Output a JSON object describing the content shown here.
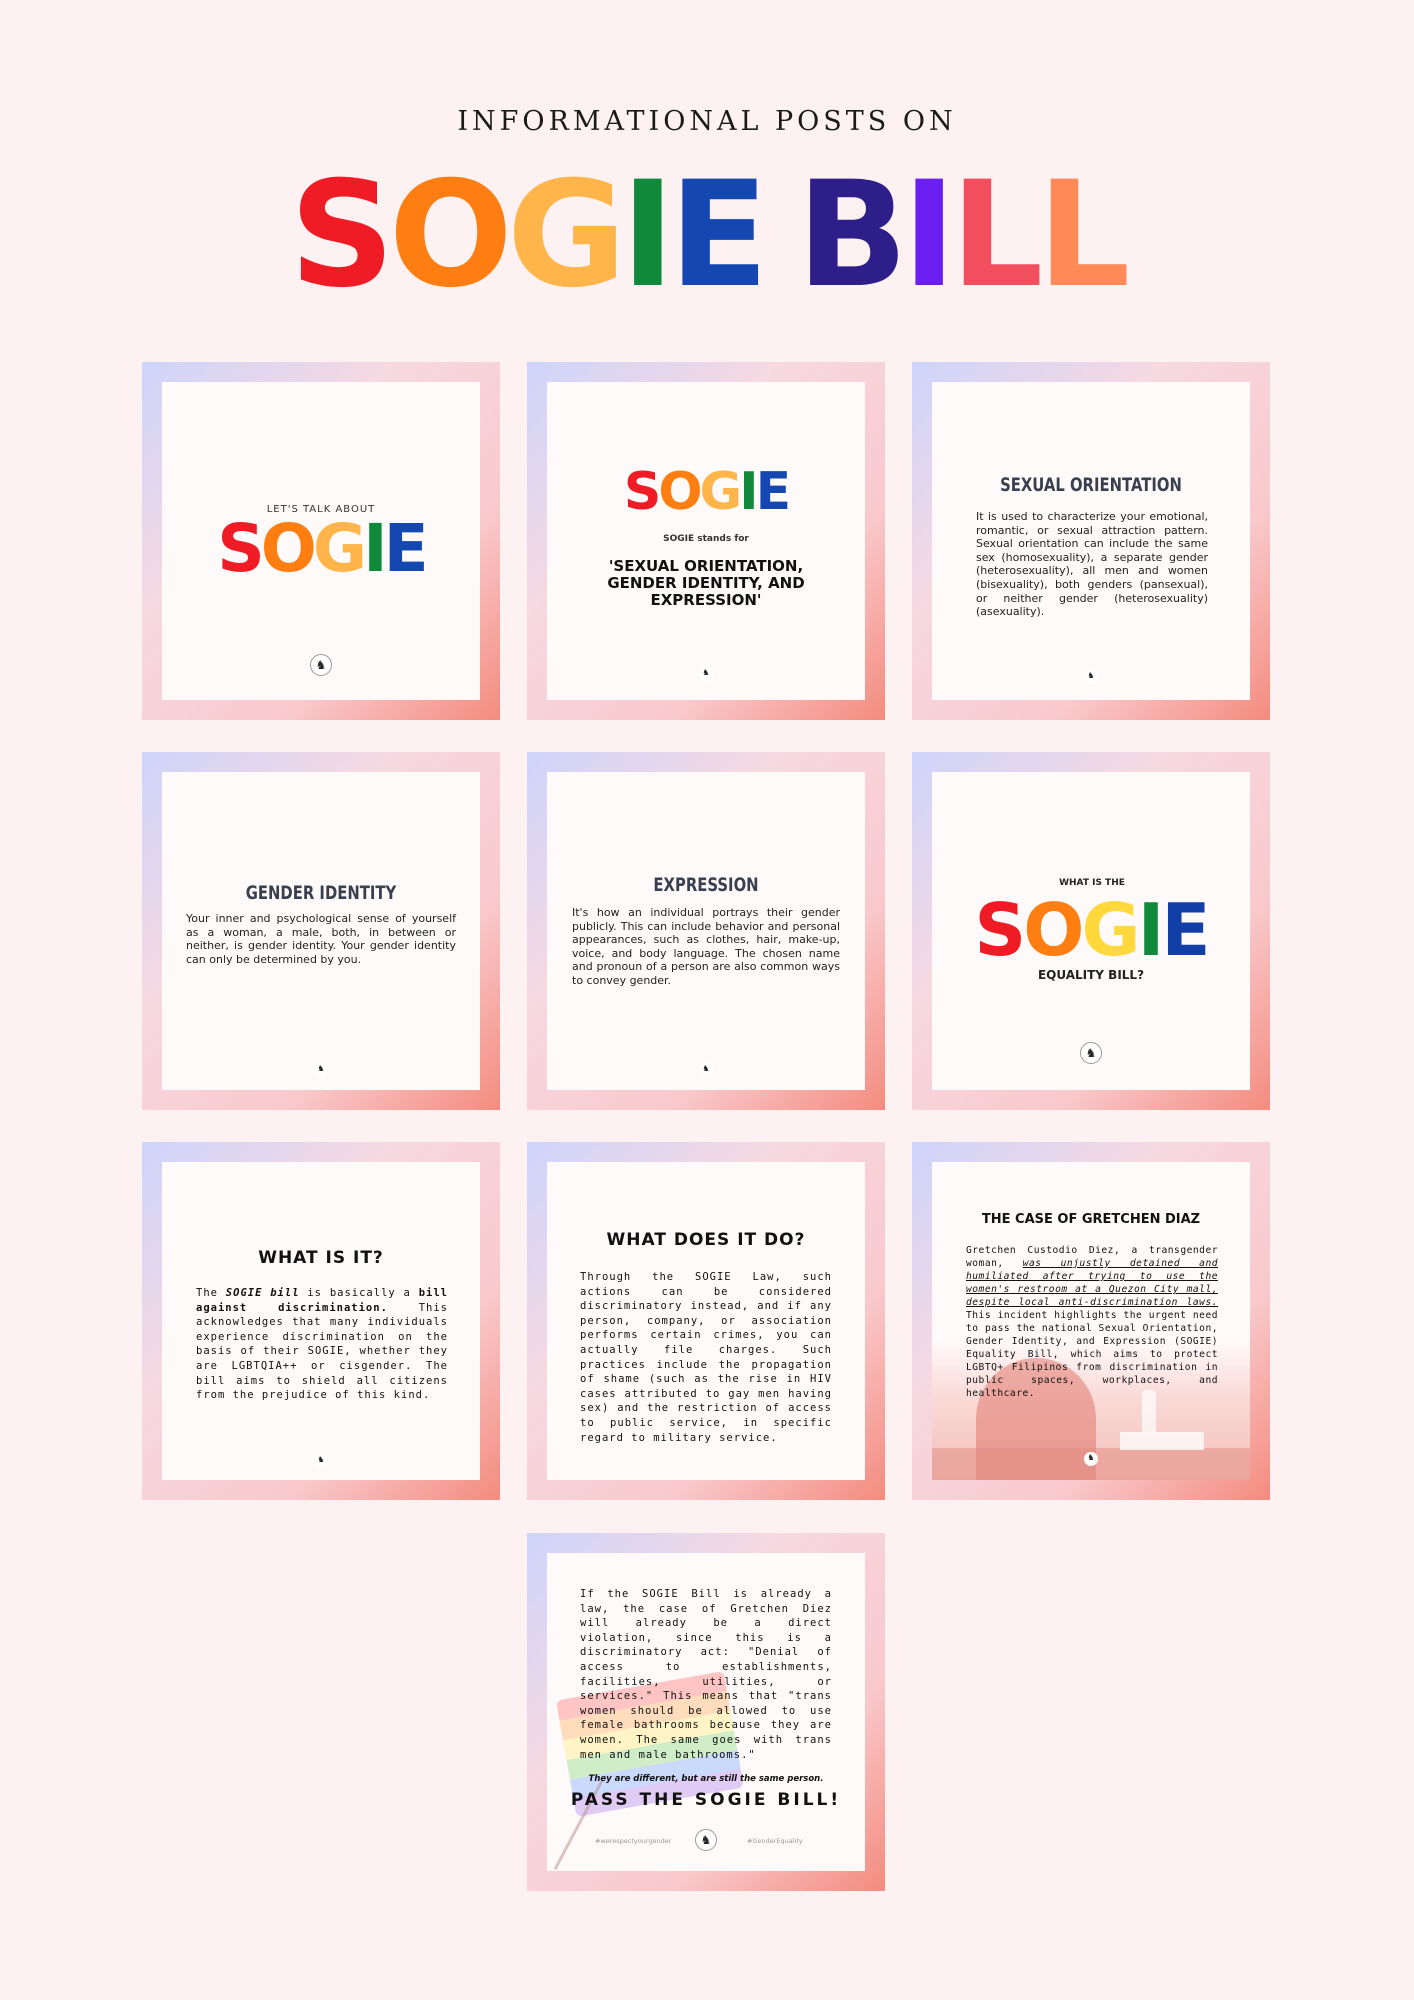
{
  "header": {
    "subtitle": "INFORMATIONAL POSTS ON",
    "title_letters": [
      "S",
      "O",
      "G",
      "I",
      "E",
      " ",
      "B",
      "I",
      "L",
      "L"
    ],
    "title_colors": [
      "#ef1c25",
      "#ff7e12",
      "#ffb54a",
      "#108a3a",
      "#1448b0",
      "",
      "#2d1e8a",
      "#6a1ef0",
      "#f24f5e",
      "#ff8a57"
    ]
  },
  "logo_glyph": "♞",
  "sogie_letters": [
    "S",
    "O",
    "G",
    "I",
    "E"
  ],
  "posts": {
    "p1": {
      "kicker": "LET'S TALK ABOUT"
    },
    "p2": {
      "stands_for": "SOGIE stands for",
      "expansion": "'SEXUAL ORIENTATION, GENDER IDENTITY, AND EXPRESSION'"
    },
    "p3": {
      "heading": "SEXUAL ORIENTATION",
      "body": "It is used to characterize your emotional, romantic, or sexual attraction pattern. Sexual orientation can include the same sex (homosexuality), a separate gender (heterosexuality), all men and women (bisexuality), both genders (pansexual), or neither gender (heterosexuality) (asexuality)."
    },
    "p4": {
      "heading": "GENDER IDENTITY",
      "body": "Your inner and psychological sense of yourself as a woman, a male, both, in between or neither, is gender identity. Your gender identity can only be determined by you."
    },
    "p5": {
      "heading": "EXPRESSION",
      "body": "It's how an individual portrays their gender publicly. This can include behavior and personal appearances, such as clothes, hair, make-up, voice, and body language. The chosen name and pronoun of a person are also common ways to convey gender."
    },
    "p6": {
      "kicker": "WHAT IS THE",
      "footer": "EQUALITY BILL?"
    },
    "p7": {
      "heading": "WHAT IS IT?",
      "t1": "The ",
      "t2": "SOGIE bill",
      "t3": " is basically a ",
      "t4": "bill against discrimination.",
      "t5": " This acknowledges that many individuals experience discrimination on the basis of their SOGIE, whether they are LGBTQIA++ or cisgender. The bill aims to shield all citizens from the prejudice of this kind."
    },
    "p8": {
      "heading": "WHAT DOES IT DO?",
      "body": "Through the SOGIE Law, such actions can be considered discriminatory instead, and if any person, company, or association performs certain crimes, you can actually file charges. Such practices include the propagation of shame (such as the rise in HIV cases attributed to gay men having sex) and the restriction of access to public service, in specific regard to military service."
    },
    "p9": {
      "heading": "THE CASE OF GRETCHEN DIAZ",
      "t1": "Gretchen Custodio Diez, a transgender woman, ",
      "t2": "was unjustly detained and humiliated after trying to use the women's restroom at a Quezon City mall, despite local anti-discrimination laws.",
      "t3": " This incident highlights the urgent need to pass the national Sexual Orientation, Gender Identity, and Expression (SOGIE) Equality Bill, which aims to protect LGBTQ+ Filipinos from discrimination in public spaces, workplaces, and healthcare."
    },
    "p10": {
      "body": "If the SOGIE Bill is already a law, the case of Gretchen Diez will already be a direct violation, since this is a discriminatory act: \"Denial of access to establishments, facilities, utilities, or services.\" This means that \"trans women should be allowed to use female bathrooms because they are women. The same goes with trans men and male bathrooms.\"",
      "tagline": "They are different, but are still the same person.",
      "cta": "PASS THE SOGIE BILL!",
      "hashtag_left": "#werespectyourgender",
      "hashtag_right": "#GenderEquality"
    }
  }
}
